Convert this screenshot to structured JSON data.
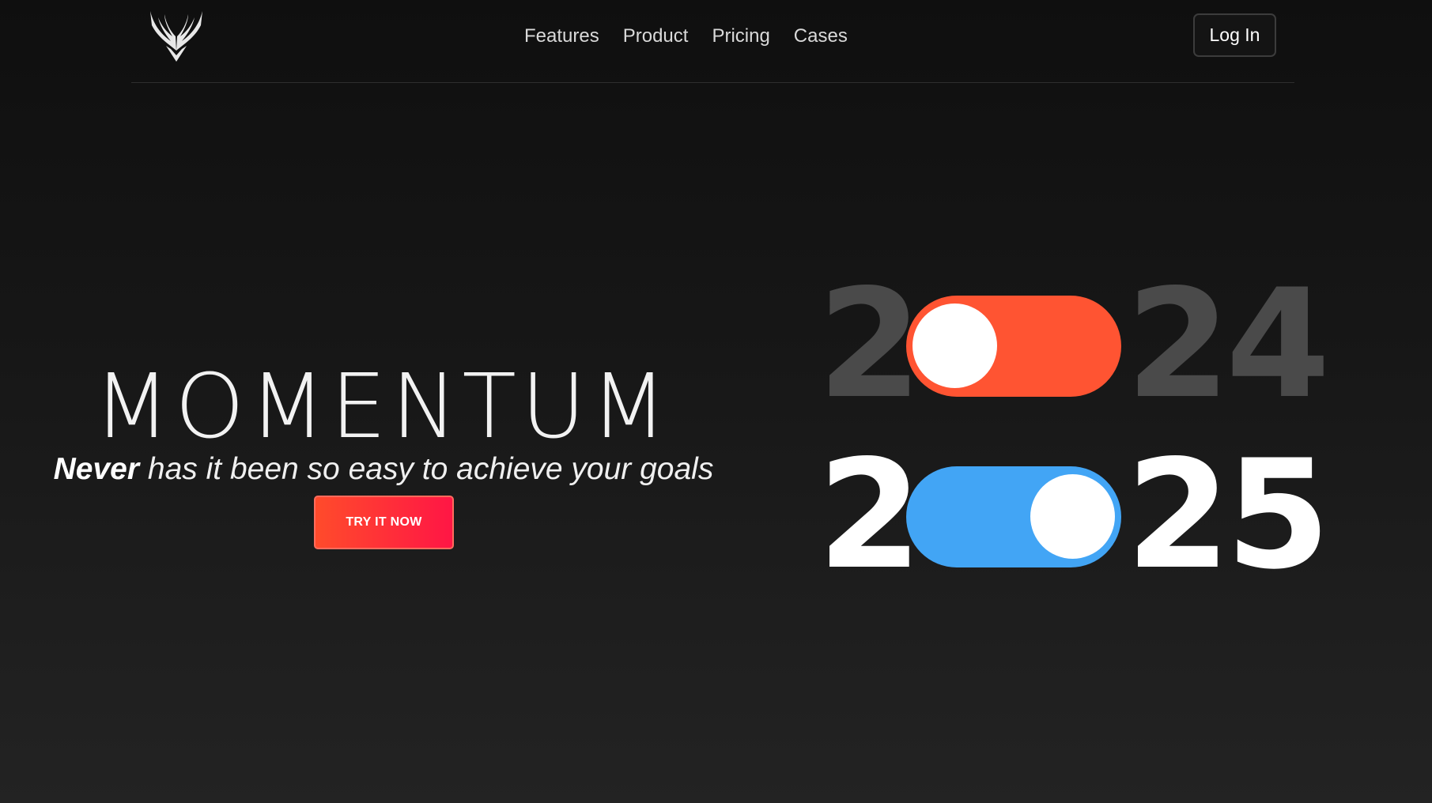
{
  "header": {
    "logo_icon": "winged-logo-icon",
    "nav": [
      {
        "label": "Features"
      },
      {
        "label": "Product"
      },
      {
        "label": "Pricing"
      },
      {
        "label": "Cases"
      }
    ],
    "login_label": "Log In"
  },
  "hero": {
    "title": "MOMENTUM",
    "tagline_emphasis": "Never",
    "tagline_rest": " has it been so easy to achieve your goals",
    "cta_label": "TRY IT NOW"
  },
  "years": {
    "previous": {
      "first_digit": "2",
      "rest_digits": "24",
      "toggle_state": "off",
      "toggle_color": "#ff5432",
      "digit_color": "#4a4a4a"
    },
    "current": {
      "first_digit": "2",
      "rest_digits": "25",
      "toggle_state": "on",
      "toggle_color": "#42a5f5",
      "digit_color": "#ffffff"
    }
  },
  "colors": {
    "background": "#121212",
    "cta_gradient_start": "#ff4b2b",
    "cta_gradient_end": "#ff1645"
  }
}
